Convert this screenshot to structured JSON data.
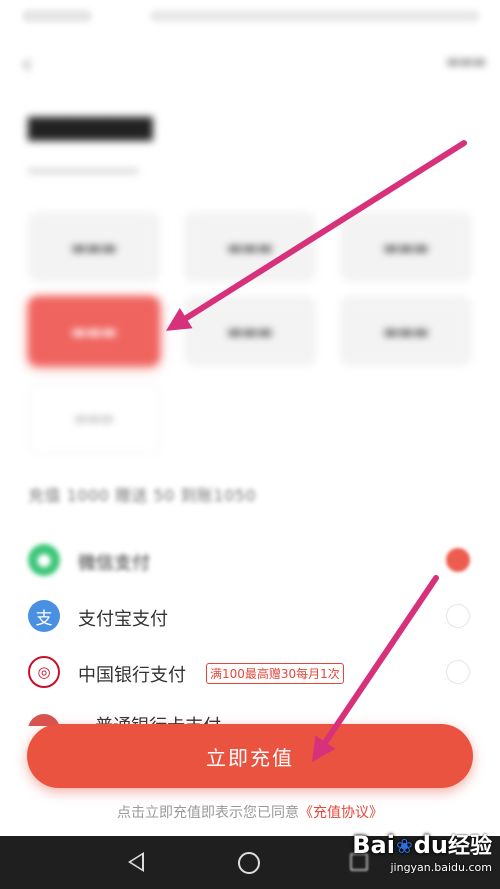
{
  "payment": {
    "bonus_text": "充值 1000 赠送 50 到账1050",
    "methods": [
      {
        "label": "微信支付",
        "icon": "wechat-icon",
        "color": "#3fc77a",
        "icon_glyph": "●",
        "selected": true
      },
      {
        "label": "支付宝支付",
        "icon": "alipay-icon",
        "color": "#4a90e2",
        "icon_glyph": "支",
        "selected": false
      },
      {
        "label": "中国银行支付",
        "icon": "boc-icon",
        "color": "#c8102e",
        "icon_glyph": "◎",
        "promo": "满100最高赠30每月1次",
        "selected": false
      },
      {
        "label": "...普通银行卡支付",
        "icon": "bank-icon",
        "color": "#d9534f",
        "icon_glyph": "●",
        "selected": false
      }
    ]
  },
  "recharge_button": "立即充值",
  "agreement": {
    "prefix": "点击立即充值即表示您已同意",
    "link": "《充值协议》"
  },
  "watermark": {
    "brand_a": "Bai",
    "brand_b": "du",
    "brand_cn": "经验",
    "url": "jingyan.baidu.com"
  },
  "colors": {
    "accent": "#e9533f",
    "selected_amount": "#f0645f",
    "annotation_arrow": "#d6317a"
  }
}
